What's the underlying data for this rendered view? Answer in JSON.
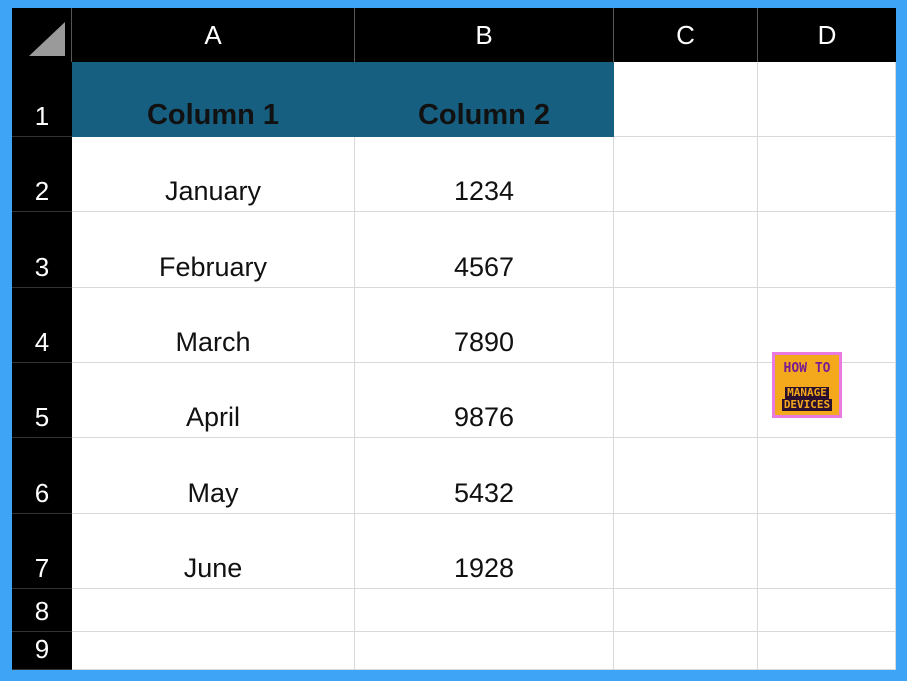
{
  "columns": [
    "A",
    "B",
    "C",
    "D"
  ],
  "rows": [
    "1",
    "2",
    "3",
    "4",
    "5",
    "6",
    "7",
    "8",
    "9"
  ],
  "header": {
    "col1": "Column 1",
    "col2": "Column 2"
  },
  "data": [
    {
      "month": "January",
      "value": "1234"
    },
    {
      "month": "February",
      "value": "4567"
    },
    {
      "month": "March",
      "value": "7890"
    },
    {
      "month": "April",
      "value": "9876"
    },
    {
      "month": "May",
      "value": "5432"
    },
    {
      "month": "June",
      "value": "1928"
    }
  ],
  "logo": {
    "line1": "HOW TO",
    "line2": "MANAGE",
    "line3": "DEVICES"
  },
  "colors": {
    "header_fill": "#175f80",
    "frame": "#3ea4f5"
  }
}
